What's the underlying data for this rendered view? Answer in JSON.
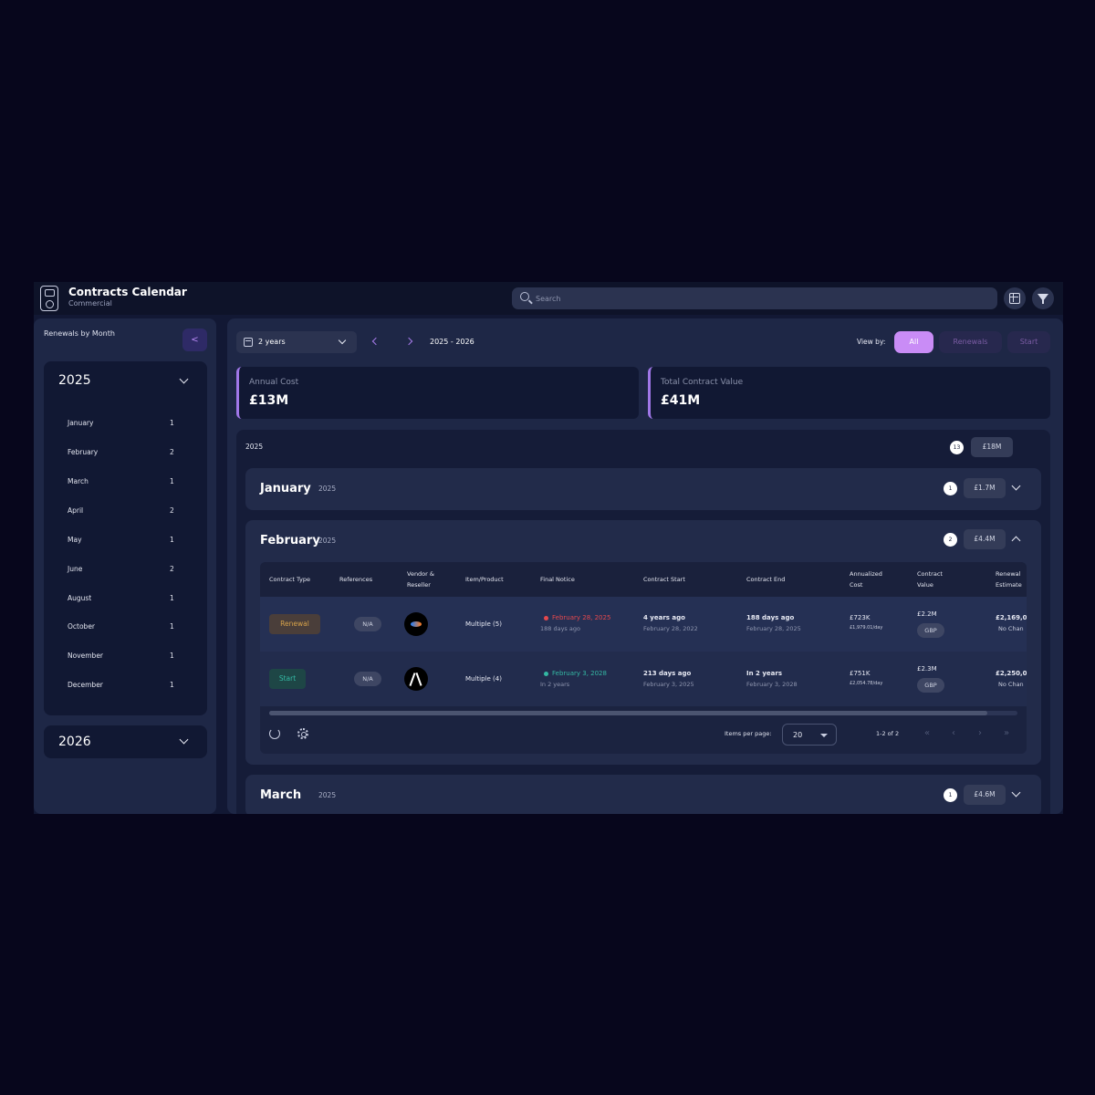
{
  "app": {
    "title": "Contracts Calendar",
    "subtitle": "Commercial"
  },
  "search": {
    "placeholder": "Search",
    "value": ""
  },
  "topbar": {
    "icons": [
      "table-plus-icon",
      "filter-icon"
    ]
  },
  "sidebar": {
    "title": "Renewals by Month",
    "collapse_icon": "<",
    "years": [
      {
        "label": "2025",
        "expanded": true,
        "months": [
          {
            "name": "January",
            "count": "1"
          },
          {
            "name": "February",
            "count": "2"
          },
          {
            "name": "March",
            "count": "1"
          },
          {
            "name": "April",
            "count": "2"
          },
          {
            "name": "May",
            "count": "1"
          },
          {
            "name": "June",
            "count": "2"
          },
          {
            "name": "August",
            "count": "1"
          },
          {
            "name": "October",
            "count": "1"
          },
          {
            "name": "November",
            "count": "1"
          },
          {
            "name": "December",
            "count": "1"
          }
        ]
      },
      {
        "label": "2026",
        "expanded": false
      }
    ]
  },
  "toolbar": {
    "range_value": "2 years",
    "range_label": "2025 - 2026",
    "view_by_label": "View by:",
    "view_options": [
      "All",
      "Renewals",
      "Start"
    ],
    "active_view": "All"
  },
  "kpis": [
    {
      "label": "Annual Cost",
      "value": "£13M"
    },
    {
      "label": "Total Contract Value",
      "value": "£41M"
    }
  ],
  "year_panel": {
    "label": "2025",
    "count": "13",
    "total": "£18M",
    "months": [
      {
        "name": "January",
        "year": "2025",
        "count": "1",
        "total": "£1.7M"
      },
      {
        "name": "February",
        "year": "2025",
        "count": "2",
        "total": "£4.4M"
      },
      {
        "name": "March",
        "year": "2025",
        "count": "1",
        "total": "£4.6M"
      }
    ]
  },
  "table": {
    "headers": [
      "Contract Type",
      "References",
      "Vendor & Reseller",
      "Item/Product",
      "Final Notice",
      "Contract Start",
      "Contract End",
      "Annualized Cost",
      "Contract Value",
      "Renewal Estimate"
    ],
    "rows": [
      {
        "type": "Renewal",
        "references": "N/A",
        "item": "Multiple (5)",
        "final_notice": "February 28, 2025",
        "final_notice_sub": "188 days ago",
        "start_rel": "4 years ago",
        "start_date": "February 28, 2022",
        "end_rel": "188 days ago",
        "end_date": "February 28, 2025",
        "annual_cost": "£723K",
        "annual_cost_day": "£1,979.01/day",
        "contract_value": "£2.2M",
        "currency": "GBP",
        "renewal_estimate": "£2,169,0",
        "renewal_note": "No Chan"
      },
      {
        "type": "Start",
        "references": "N/A",
        "item": "Multiple (4)",
        "final_notice": "February 3, 2028",
        "final_notice_sub": "In 2 years",
        "start_rel": "213 days ago",
        "start_date": "February 3, 2025",
        "end_rel": "In 2 years",
        "end_date": "February 3, 2028",
        "annual_cost": "£751K",
        "annual_cost_day": "£2,054.78/day",
        "contract_value": "£2.3M",
        "currency": "GBP",
        "renewal_estimate": "£2,250,0",
        "renewal_note": "No Chan"
      }
    ],
    "colors": {
      "renewal": "#d7a24a",
      "start": "#34b8a3",
      "overdue": "#e5484d"
    }
  },
  "pagination": {
    "items_per_page_label": "Items per page:",
    "items_per_page": "20",
    "range": "1-2 of 2",
    "icons": [
      "first-page-icon",
      "prev-page-icon",
      "next-page-icon",
      "last-page-icon"
    ]
  },
  "colors": {
    "accent": "#c98cf6",
    "background": "#07061c",
    "panel": "#1e2746"
  }
}
